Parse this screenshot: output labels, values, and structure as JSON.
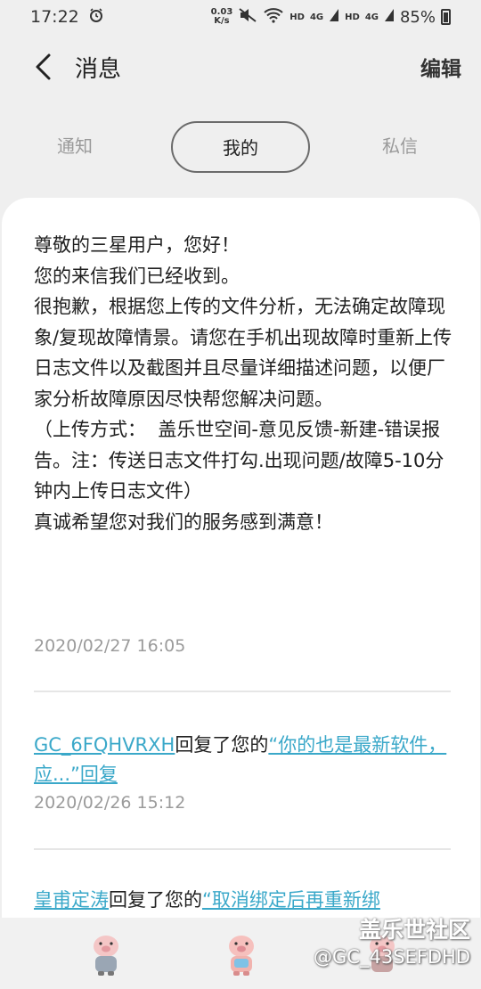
{
  "status_bar": {
    "time": "17:22",
    "net_speed_value": "0.03",
    "net_speed_unit": "K/s",
    "hd1": "HD",
    "sim1": "4G",
    "hd2": "HD",
    "sim2": "4G",
    "battery": "85%"
  },
  "header": {
    "title": "消息",
    "edit_label": "编辑"
  },
  "tabs": [
    {
      "label": "通知"
    },
    {
      "label": "我的"
    },
    {
      "label": "私信"
    }
  ],
  "messages": {
    "first": {
      "body": "尊敬的三星用户，您好！\n您的来信我们已经收到。\n很抱歉，根据您上传的文件分析，无法确定故障现象/复现故障情景。请您在手机出现故障时重新上传日志文件以及截图并且尽量详细描述问题，以便厂家分析故障原因尽快帮您解决问题。\n（上传方式：  盖乐世空间-意见反馈-新建-错误报告。注：传送日志文件打勾.出现问题/故障5-10分钟内上传日志文件）\n真诚希望您对我们的服务感到满意！",
      "time": "2020/02/27 16:05"
    },
    "second": {
      "user": "GC_6FQHVRXH",
      "middle": "回复了您的",
      "quote": "“你的也是最新软件，应...”回复",
      "time": "2020/02/26 15:12"
    },
    "third": {
      "user": "皇甫定涛",
      "middle": "回复了您的",
      "quote": "“取消绑定后再重新绑"
    }
  },
  "watermark": {
    "title": "盖乐世社区",
    "handle": "@GC_43SEFDHD"
  },
  "colors": {
    "link": "#3aa8c9",
    "background": "#efefef",
    "card": "#ffffff"
  }
}
